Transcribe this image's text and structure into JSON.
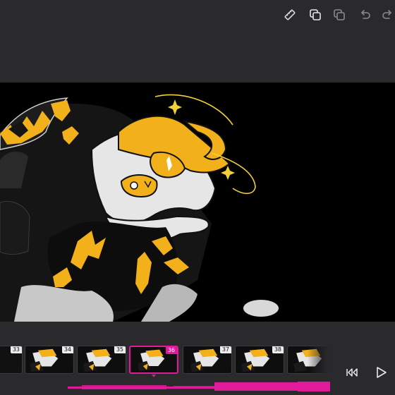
{
  "toolbar": {
    "tools": [
      {
        "icon": "ruler-icon"
      },
      {
        "icon": "duplicate-icon"
      },
      {
        "icon": "layers-icon"
      },
      {
        "icon": "undo-icon"
      },
      {
        "icon": "redo-icon"
      }
    ]
  },
  "timeline": {
    "frames": [
      {
        "number": "33"
      },
      {
        "number": "34"
      },
      {
        "number": "35"
      },
      {
        "number": "36"
      },
      {
        "number": "37"
      },
      {
        "number": "38"
      },
      {
        "number": ""
      }
    ],
    "active_frame": "36",
    "accent_color": "#e01a9a"
  },
  "controls": {
    "rewind_icon": "skip-to-start-icon",
    "play_icon": "play-icon"
  },
  "colors": {
    "background": "#2a2a2c",
    "canvas": "#000000",
    "character_yellow": "#f2b01a",
    "character_white": "#e8e8e8"
  }
}
